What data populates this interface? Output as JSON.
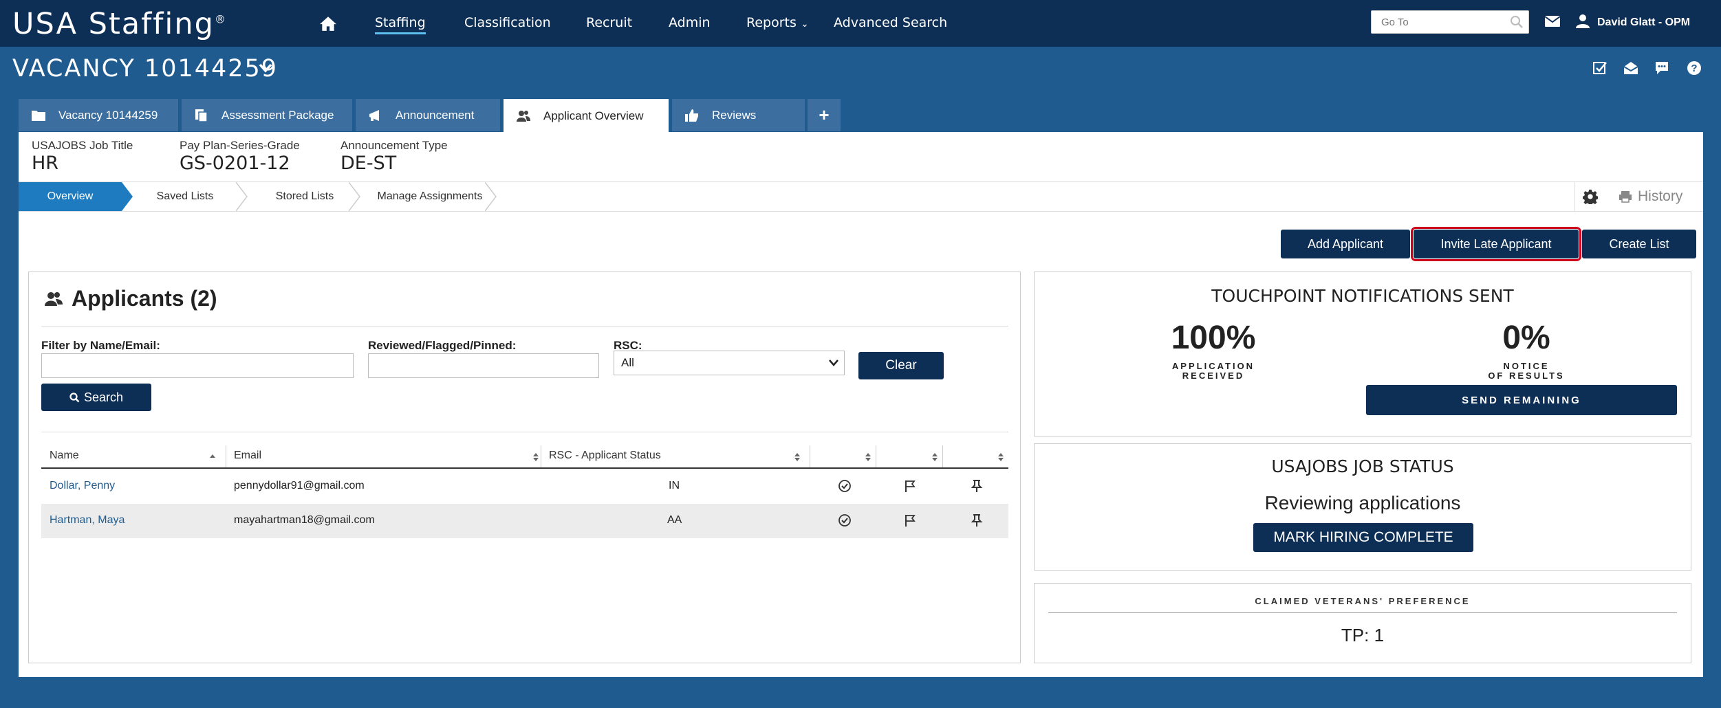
{
  "app": {
    "logo": "USA Staffing",
    "logo_mark": "®"
  },
  "nav": {
    "items": [
      "Staffing",
      "Classification",
      "Recruit",
      "Admin",
      "Reports",
      "Advanced Search"
    ],
    "active": "Staffing",
    "goto_placeholder": "Go To",
    "user": "David Glatt - OPM"
  },
  "vacancy": {
    "title": "VACANCY 10144259"
  },
  "tabs": [
    {
      "label": "Vacancy 10144259",
      "icon": "folder-icon"
    },
    {
      "label": "Assessment Package",
      "icon": "documents-icon"
    },
    {
      "label": "Announcement",
      "icon": "megaphone-icon"
    },
    {
      "label": "Applicant Overview",
      "icon": "users-icon",
      "active": true
    },
    {
      "label": "Reviews",
      "icon": "thumbs-up-icon"
    },
    {
      "label": "+",
      "icon": "plus-icon"
    }
  ],
  "meta": {
    "job_title_label": "USAJOBS Job Title",
    "job_title": "HR",
    "grade_label": "Pay Plan-Series-Grade",
    "grade": "GS-0201-12",
    "type_label": "Announcement Type",
    "type": "DE-ST"
  },
  "breadcrumbs": [
    "Overview",
    "Saved Lists",
    "Stored Lists",
    "Manage Assignments"
  ],
  "history_label": "History",
  "actions": {
    "add": "Add Applicant",
    "invite": "Invite Late Applicant",
    "create": "Create List"
  },
  "applicants": {
    "title": "Applicants (2)",
    "filter_label": "Filter by Name/Email:",
    "reviewed_label": "Reviewed/Flagged/Pinned:",
    "rsc_label": "RSC:",
    "rsc_value": "All",
    "clear": "Clear",
    "search": "Search",
    "columns": [
      "Name",
      "Email",
      "RSC - Applicant Status"
    ],
    "rows": [
      {
        "name": "Dollar, Penny",
        "email": "pennydollar91@gmail.com",
        "status": "IN"
      },
      {
        "name": "Hartman, Maya",
        "email": "mayahartman18@gmail.com",
        "status": "AA"
      }
    ]
  },
  "touchpoint": {
    "title": "TOUCHPOINT NOTIFICATIONS SENT",
    "received_pct": "100%",
    "received_label_1": "APPLICATION",
    "received_label_2": "RECEIVED",
    "notice_pct": "0%",
    "notice_label_1": "NOTICE",
    "notice_label_2": "OF RESULTS",
    "send": "SEND REMAINING"
  },
  "job_status": {
    "title": "USAJOBS JOB STATUS",
    "status": "Reviewing applications",
    "button": "MARK HIRING COMPLETE"
  },
  "veterans": {
    "title": "CLAIMED VETERANS' PREFERENCE",
    "value": "TP: 1"
  },
  "colors": {
    "nav_bg": "#0e2f55",
    "page_bg": "#1f5b8f",
    "accent": "#1f7bc0",
    "highlight": "#d0021b"
  }
}
